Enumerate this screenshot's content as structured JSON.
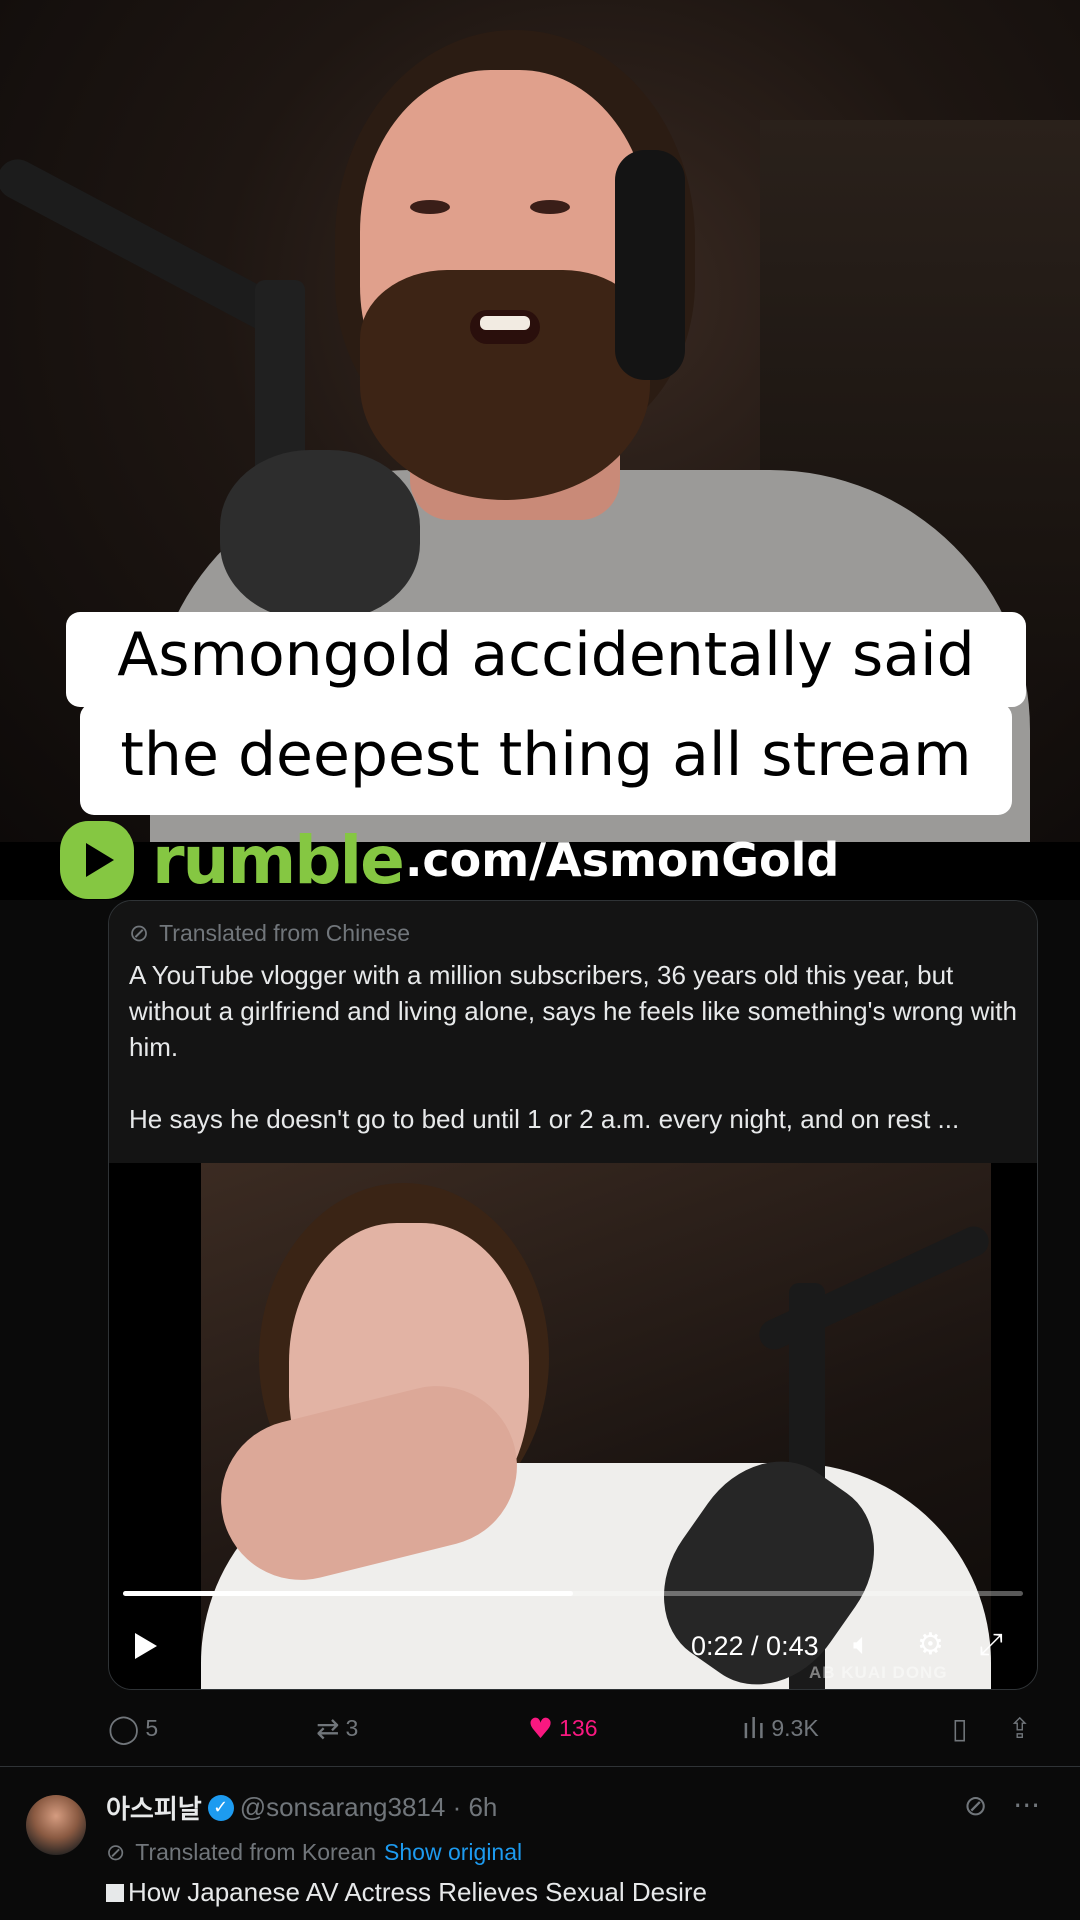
{
  "caption": {
    "line1": "Asmongold accidentally said",
    "line2": "the deepest thing all stream"
  },
  "rumble": {
    "word": "rumble",
    "url": ".com/AsmonGold",
    "brand_color": "#85c742"
  },
  "quoted_post": {
    "translated_label": "Translated from Chinese",
    "paragraph1": "A YouTube vlogger with a million subscribers, 36 years old this year, but without a girlfriend and living alone, says he feels like something's wrong with him.",
    "paragraph2": "He says he doesn't go to bed until 1 or 2 a.m. every night, and on rest ...",
    "video": {
      "time": "0:22 / 0:43",
      "progress_fraction": 0.5,
      "watermark": "AB KUAI DONG"
    }
  },
  "actions": {
    "replies": "5",
    "reposts": "3",
    "likes": "136",
    "views": "9.3K",
    "like_color": "#f91880"
  },
  "reply_post": {
    "name": "아스피날",
    "handle": "@sonsarang3814 · 6h",
    "translated_label": "Translated from Korean",
    "show_original": "Show original",
    "body": "How Japanese AV Actress Relieves Sexual Desire"
  }
}
